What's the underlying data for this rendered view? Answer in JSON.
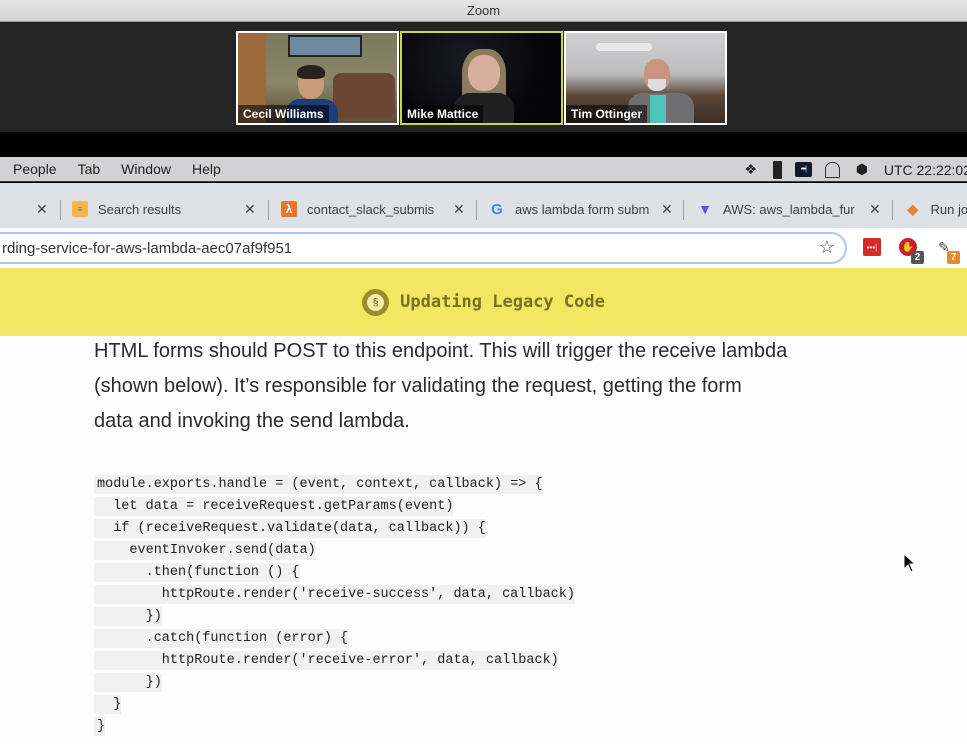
{
  "zoom": {
    "window_title": "Zoom",
    "participants": [
      {
        "name": "Cecil Williams",
        "active": false
      },
      {
        "name": "Mike Mattice",
        "active": true
      },
      {
        "name": "Tim Ottinger",
        "active": false
      }
    ],
    "active_speaker_color": "#c8d84a"
  },
  "menubar": {
    "items": [
      "People",
      "Tab",
      "Window",
      "Help"
    ],
    "status_icons": [
      "dropbox-icon",
      "document-icon",
      "password-manager-icon",
      "rounded-window-icon",
      "package-icon"
    ],
    "clock": "UTC 22:22:02"
  },
  "tabs": [
    {
      "label": "",
      "favicon": "none"
    },
    {
      "label": "Search results",
      "favicon": "search-results-icon"
    },
    {
      "label": "contact_slack_submis",
      "favicon": "aws-lambda-icon"
    },
    {
      "label": "aws lambda form subm",
      "favicon": "google-icon"
    },
    {
      "label": "AWS: aws_lambda_fur",
      "favicon": "terraform-icon"
    },
    {
      "label": "Run jo",
      "favicon": "gitlab-icon"
    }
  ],
  "address_bar": {
    "url": "rding-service-for-aws-lambda-aec07af9f951"
  },
  "extensions": [
    {
      "name": "lastpass-icon",
      "badge": ""
    },
    {
      "name": "adblock-icon",
      "badge": "2"
    },
    {
      "name": "extension-icon",
      "badge": "7"
    }
  ],
  "banner": {
    "title": "Updating Legacy Code",
    "color": "#f2e662"
  },
  "article": {
    "paragraph_lines": [
      "HTML forms should POST to this endpoint. This will trigger the receive lambda",
      "(shown below). It’s responsible for validating the request, getting the form",
      "data and invoking the send lambda."
    ],
    "code_lines": [
      "module.exports.handle = (event, context, callback) => {",
      "  let data = receiveRequest.getParams(event)",
      "  if (receiveRequest.validate(data, callback)) {",
      "    eventInvoker.send(data)",
      "      .then(function () {",
      "        httpRoute.render('receive-success', data, callback)",
      "      })",
      "      .catch(function (error) {",
      "        httpRoute.render('receive-error', data, callback)",
      "      })",
      "  }",
      "}"
    ]
  }
}
